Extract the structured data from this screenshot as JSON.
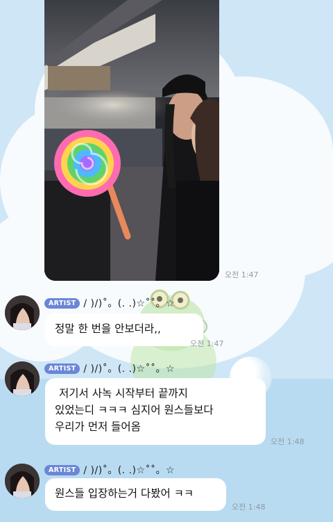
{
  "colors": {
    "bubble": "#ffffff",
    "background": "#cfe6f6",
    "badge": "#6c86d6"
  },
  "photo_message": {
    "time": "오전 1:47"
  },
  "messages": [
    {
      "badge": "ARTIST",
      "nickname": "/ )/)˚。(. .)☆˚˚。☆",
      "text": "정말 한 번을 안보더라,,",
      "time": "오전 1:47"
    },
    {
      "badge": "ARTIST",
      "nickname": "/ )/)˚。(. .)☆˚˚。☆",
      "lines": [
        "저기서 사녹 시작부터 끝까지",
        "있었는디 ㅋㅋㅋ 심지어 원스들보다",
        "우리가 먼저 들어옴"
      ],
      "time": "오전 1:48"
    },
    {
      "badge": "ARTIST",
      "nickname": "/ )/)˚。(. .)☆˚˚。☆",
      "text": "원스들 입장하는거 다봤어 ㅋㅋ",
      "time": "오전 1:48"
    }
  ]
}
